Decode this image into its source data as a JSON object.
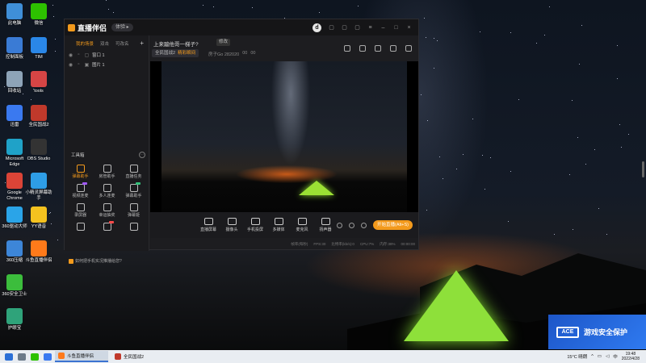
{
  "desktop": {
    "icons": [
      {
        "label": "此电脑",
        "color": "#3f8fd8"
      },
      {
        "label": "微信",
        "color": "#2dc100"
      },
      {
        "label": "控制面板",
        "color": "#3a7bd5"
      },
      {
        "label": "TIM",
        "color": "#2a87e8"
      },
      {
        "label": "回收站",
        "color": "#8ea4b8"
      },
      {
        "label": "tools",
        "color": "#d64545"
      },
      {
        "label": "迅雷",
        "color": "#3a79f0"
      },
      {
        "label": "全民国战2",
        "color": "#c0392b"
      },
      {
        "label": "Microsoft Edge",
        "color": "#1fa2c8"
      },
      {
        "label": "OBS Studio",
        "color": "#333333"
      },
      {
        "label": "Google Chrome",
        "color": "#db4437"
      },
      {
        "label": "小精灵屏幕助手",
        "color": "#2e9de6"
      },
      {
        "label": "360驱动大师",
        "color": "#2aa4e8"
      },
      {
        "label": "YY语音",
        "color": "#f4c21f"
      },
      {
        "label": "360压缩",
        "color": "#3d86d8"
      },
      {
        "label": "斗鱼直播伴侣",
        "color": "#ff7a1a"
      },
      {
        "label": "360安全卫士",
        "color": "#3cbd3c"
      },
      {
        "label": "护眼宝",
        "color": "#2fa37a"
      }
    ]
  },
  "app": {
    "logo_text": "直播伴侣",
    "version_pill": "体验 ▸",
    "scene_tabs": [
      "我的场景",
      "双击",
      "可改名"
    ],
    "scene_add": "+",
    "sources": [
      {
        "label": "窗口 1"
      },
      {
        "label": "图片 1"
      }
    ],
    "toolbox_title": "工具箱",
    "toolbox_more": "···",
    "tools": [
      {
        "label": "弹幕助手",
        "hot": true,
        "badge": "",
        "badge_color": ""
      },
      {
        "label": "房管助手",
        "hot": false,
        "badge": "",
        "badge_color": ""
      },
      {
        "label": "直播任务",
        "hot": false,
        "badge": "",
        "badge_color": ""
      },
      {
        "label": "视频连麦",
        "hot": false,
        "badge": "new",
        "badge_color": "#a259ff"
      },
      {
        "label": "多人连麦",
        "hot": false,
        "badge": "",
        "badge_color": ""
      },
      {
        "label": "弹幕助手",
        "hot": false,
        "badge": "new",
        "badge_color": "#34c27a"
      },
      {
        "label": "录屏器",
        "hot": false,
        "badge": "",
        "badge_color": ""
      },
      {
        "label": "幸运抽奖",
        "hot": false,
        "badge": "",
        "badge_color": ""
      },
      {
        "label": "弹幕姬",
        "hot": false,
        "badge": "",
        "badge_color": ""
      },
      {
        "label": "",
        "hot": false,
        "badge": "",
        "badge_color": ""
      },
      {
        "label": "",
        "hot": false,
        "badge": "hot",
        "badge_color": "#ff4a4a"
      },
      {
        "label": "",
        "hot": false,
        "badge": "",
        "badge_color": ""
      }
    ],
    "help_link": "如何把手机实况推播给您?",
    "room": {
      "title": "上来蹦他哥一梯子?",
      "edit_label": "修改",
      "category": "全民国战2",
      "category_tag": "精彩瞬间",
      "room_id": "房子Go 282020",
      "fans": "00",
      "gifts": "00"
    },
    "bottom_buttons": [
      {
        "label": "直播屏幕"
      },
      {
        "label": "摄像头"
      },
      {
        "label": "手机投屏"
      },
      {
        "label": "多媒体"
      },
      {
        "label": "麦克风"
      },
      {
        "label": "扬声器"
      }
    ],
    "start_label": "开始直播(Alt+S)",
    "status": [
      "帧率(每秒)",
      "FPS:30",
      "比特率(kb/s):0",
      "CPU:7%",
      "内存:38%",
      "00:00:00"
    ]
  },
  "banner": {
    "logo": "ACE",
    "text": "游戏安全保护"
  },
  "taskbar": {
    "apps": [
      {
        "label": "斗鱼直播伴侣",
        "color": "#ff7a1a",
        "active": true
      },
      {
        "label": "全民国战2",
        "color": "#c0392b",
        "active": false
      }
    ],
    "weather": "15°C 晴朗",
    "time": "19:48",
    "date": "2022/4/28"
  },
  "colors": {
    "accent": "#f39a1c",
    "window_bg": "#1d1d20",
    "taskbar_bg": "#e9edf2"
  }
}
